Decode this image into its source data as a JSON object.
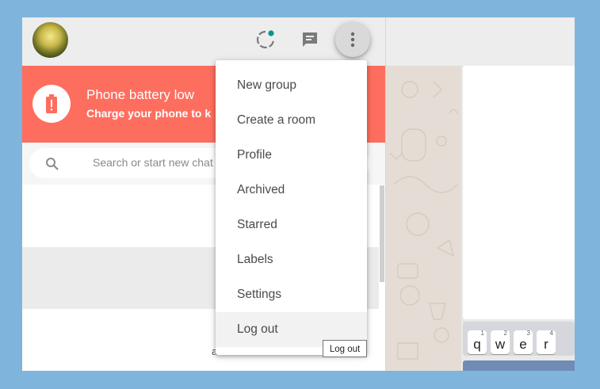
{
  "header": {
    "avatar_alt": "Profile photo",
    "icons": [
      "status-icon",
      "new-chat-icon",
      "menu-icon"
    ],
    "status_dot_color": "#009688"
  },
  "banner": {
    "title": "Phone battery low",
    "subtitle": "Charge your phone to k",
    "close_label": "×",
    "bg_color": "#fe6e5e"
  },
  "search": {
    "placeholder": "Search or start new chat"
  },
  "list": {
    "stray_text": "a"
  },
  "menu": {
    "items": [
      {
        "label": "New group"
      },
      {
        "label": "Create a room"
      },
      {
        "label": "Profile"
      },
      {
        "label": "Archived"
      },
      {
        "label": "Starred"
      },
      {
        "label": "Labels"
      },
      {
        "label": "Settings"
      },
      {
        "label": "Log out"
      }
    ],
    "hovered_item": "Log out"
  },
  "tooltip": {
    "text": "Log out"
  },
  "keyboard": {
    "keys": [
      {
        "letter": "q",
        "num": "1"
      },
      {
        "letter": "w",
        "num": "2"
      },
      {
        "letter": "e",
        "num": "3"
      },
      {
        "letter": "r",
        "num": "4"
      }
    ]
  }
}
